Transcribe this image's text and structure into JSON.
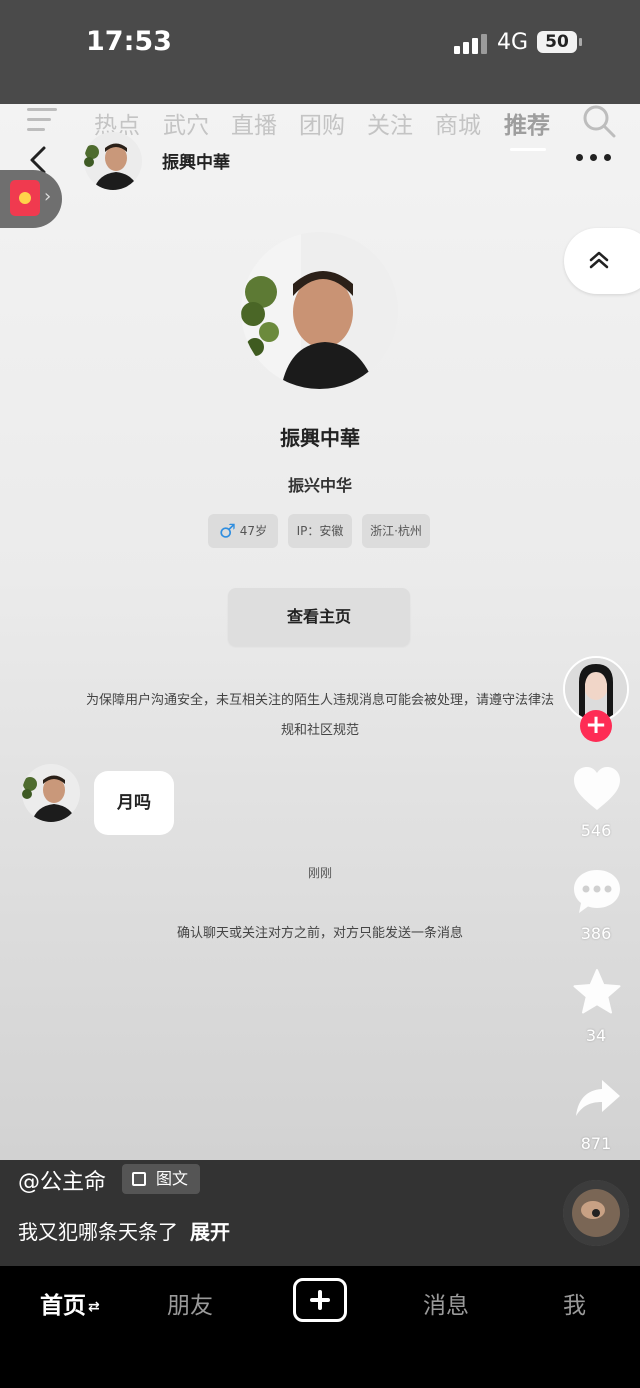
{
  "status_bar": {
    "time": "17:53",
    "network": "4G",
    "battery": "50"
  },
  "top_nav": {
    "tabs": [
      "热点",
      "武穴",
      "直播",
      "团购",
      "关注",
      "商城",
      "推荐"
    ],
    "active_tab": "推荐"
  },
  "chat_header": {
    "name": "振興中華"
  },
  "profile": {
    "name": "振興中華",
    "signature": "振兴中华",
    "tags": {
      "gender_symbol": "♂",
      "age": "47岁",
      "ip": "IP：安徽",
      "location": "浙江·杭州"
    },
    "view_home_label": "查看主页"
  },
  "notice": "为保障用户沟通安全，未互相关注的陌生人违规消息可能会被处理，请遵守法律法规和社区规范",
  "message": {
    "text": "月吗",
    "time": "刚刚",
    "hint": "确认聊天或关注对方之前，对方只能发送一条消息"
  },
  "actions": {
    "likes": "546",
    "comments": "386",
    "favorites": "34",
    "shares": "871"
  },
  "caption": {
    "author": "@公主命",
    "badge": "图文",
    "text": "我又犯哪条天条了",
    "expand": "展开"
  },
  "bottom_nav": {
    "home": "首页",
    "friends": "朋友",
    "messages": "消息",
    "me": "我"
  },
  "colors": {
    "accent": "#fe2c55",
    "gender": "#2f8ee0",
    "bottom_bar": "#000000"
  }
}
